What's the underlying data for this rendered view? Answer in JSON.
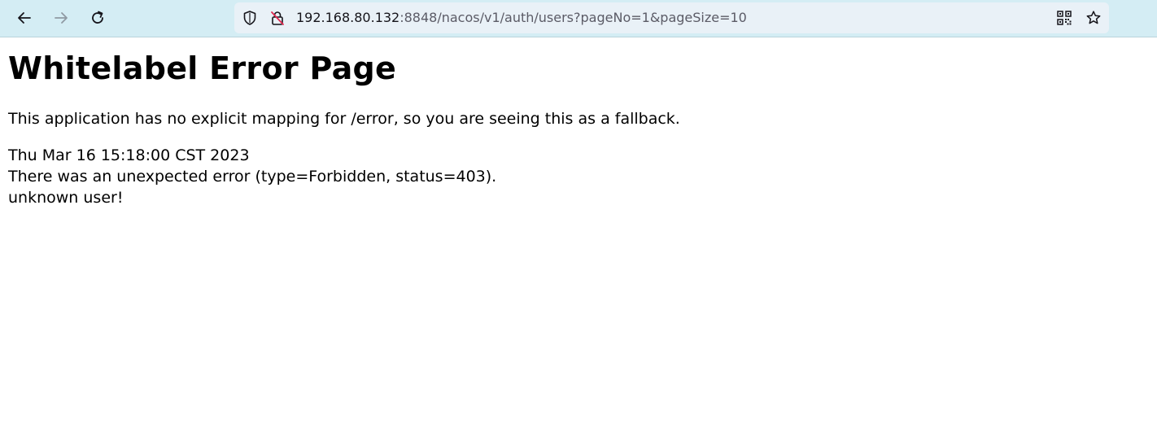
{
  "browser": {
    "nav": {
      "back": "arrow-left-icon",
      "forward": "arrow-right-icon",
      "reload": "reload-icon"
    },
    "url": {
      "host": "192.168.80.132",
      "rest": ":8848/nacos/v1/auth/users?pageNo=1&pageSize=10"
    },
    "icons": {
      "security": "shield-icon",
      "insecure": "insecure-lock-icon",
      "qr": "qr-code-icon",
      "bookmark": "star-icon"
    }
  },
  "page": {
    "title": "Whitelabel Error Page",
    "description": "This application has no explicit mapping for /error, so you are seeing this as a fallback.",
    "timestamp": "Thu Mar 16 15:18:00 CST 2023",
    "error_line": "There was an unexpected error (type=Forbidden, status=403).",
    "message": "unknown user!"
  }
}
